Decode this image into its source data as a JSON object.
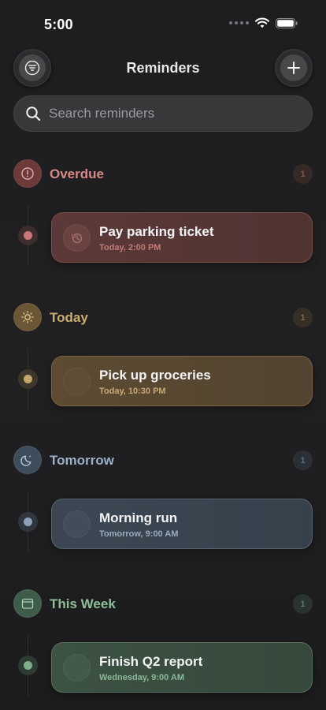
{
  "status_bar": {
    "time": "5:00"
  },
  "header": {
    "title": "Reminders"
  },
  "search": {
    "placeholder": "Search reminders",
    "value": ""
  },
  "sections": [
    {
      "title": "Overdue",
      "count": "1",
      "icon": "alert-circle-icon",
      "accent": "#d68a86",
      "reminder": {
        "title": "Pay parking ticket",
        "subtitle": "Today, 2:00 PM",
        "icon": "history-icon"
      }
    },
    {
      "title": "Today",
      "count": "1",
      "icon": "sun-icon",
      "accent": "#cfac70",
      "reminder": {
        "title": "Pick up groceries",
        "subtitle": "Today, 10:30 PM"
      }
    },
    {
      "title": "Tomorrow",
      "count": "1",
      "icon": "moon-icon",
      "accent": "#9bb0c6",
      "reminder": {
        "title": "Morning run",
        "subtitle": "Tomorrow, 9:00 AM"
      }
    },
    {
      "title": "This Week",
      "count": "1",
      "icon": "calendar-icon",
      "accent": "#8fbf9a",
      "reminder": {
        "title": "Finish Q2 report",
        "subtitle": "Wednesday, 9:00 AM"
      }
    }
  ]
}
